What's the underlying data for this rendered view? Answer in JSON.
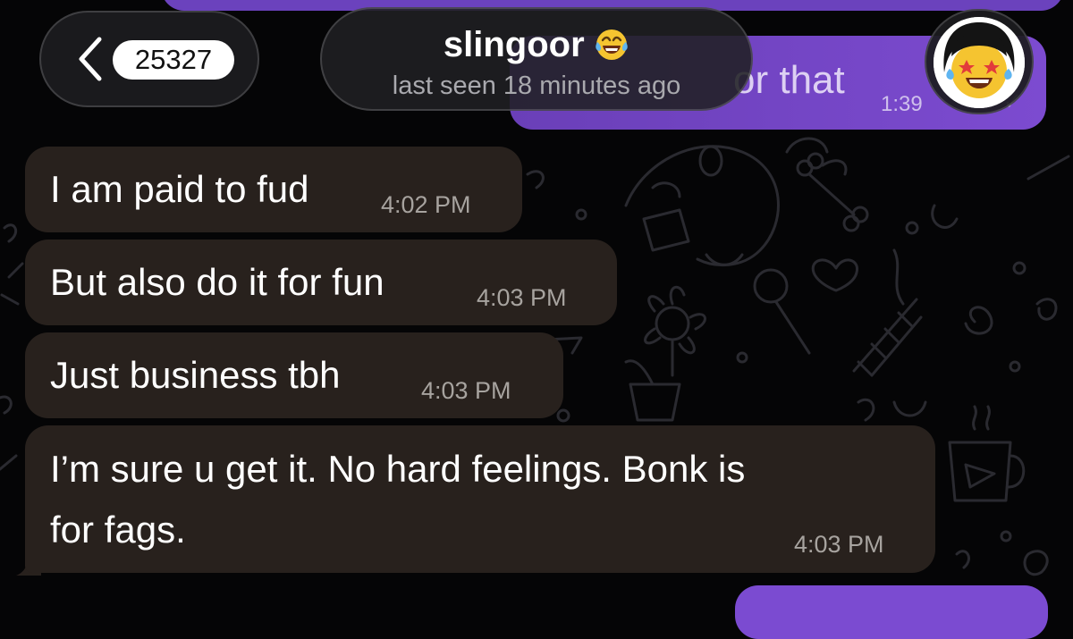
{
  "header": {
    "unread_count": "25327",
    "contact_name": "slingoor",
    "last_seen": "last seen 18 minutes ago"
  },
  "outgoing_partial": {
    "text": "or that",
    "time": "1:39",
    "status_icon": "double-check-icon"
  },
  "messages": [
    {
      "text": "I am paid to fud",
      "time": "4:02 PM"
    },
    {
      "text": "But also do it for fun",
      "time": "4:03 PM"
    },
    {
      "text": "Just business tbh",
      "time": "4:03 PM"
    },
    {
      "lines": [
        "I’m sure u get it. No hard feelings. Bonk is",
        "for fags."
      ],
      "time": "4:03 PM"
    }
  ],
  "icons": {
    "back": "chevron-left-icon",
    "name_emoji": "crying-laughing-emoji-icon",
    "avatar": "contact-avatar"
  },
  "colors": {
    "background": "#050506",
    "incoming_bubble": "#28211d",
    "outgoing_bubble": "#7b4bd1",
    "header_pill": "#1c1c1f",
    "timestamp": "#a7a39f"
  }
}
